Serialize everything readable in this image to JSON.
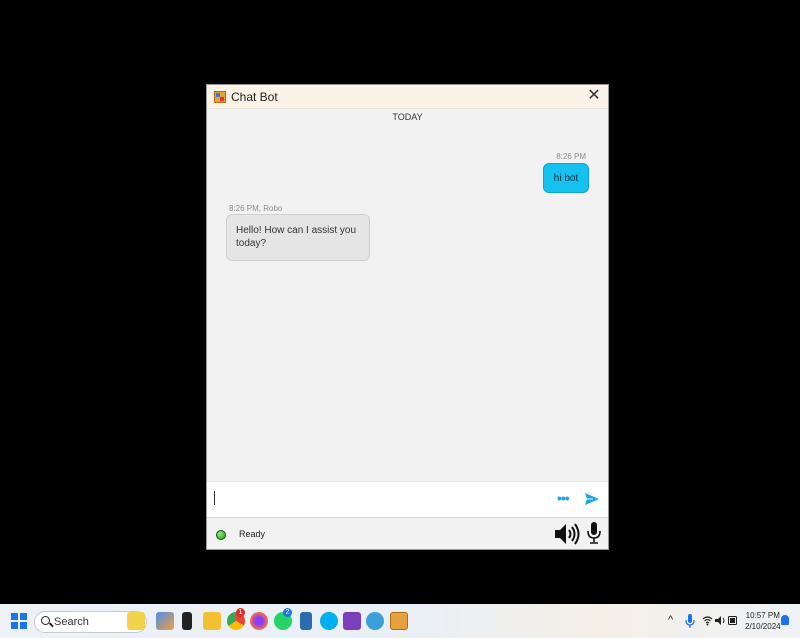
{
  "window": {
    "title": "Chat Bot",
    "close_label": "✕"
  },
  "chat": {
    "day_label": "TODAY",
    "messages": [
      {
        "sender": "user",
        "time": "8:26 PM",
        "text": "hi bot"
      },
      {
        "sender": "bot",
        "time": "8:26 PM, Robo",
        "text": "Hello! How can I assist you today?"
      }
    ]
  },
  "input": {
    "value": "",
    "more_label": "•••"
  },
  "status": {
    "text": "Ready"
  },
  "taskbar": {
    "search_placeholder": "Search",
    "tray_arrow": "^",
    "time": "10:57 PM",
    "date": "2/10/2024",
    "badges": {
      "chrome": "1",
      "whatsapp": "2"
    }
  },
  "colors": {
    "user_bubble": "#17c1ef",
    "bot_bubble": "#e5e5e5",
    "accent": "#1aa6e5",
    "status_led": "#2ebd1f"
  }
}
